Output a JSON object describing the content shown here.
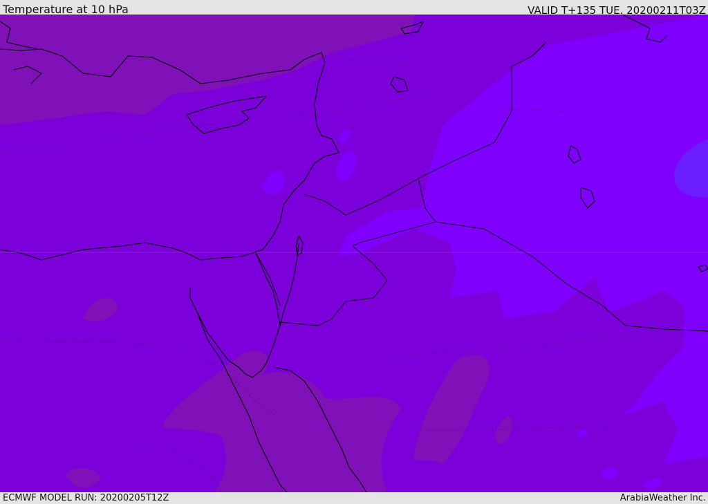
{
  "header": {
    "title": "Temperature at 10 hPa",
    "valid": "VALID T+135 TUE. 20200211T03Z"
  },
  "footer": {
    "model_run": "ECMWF MODEL RUN: 20200205T12Z",
    "credit": "ArabiaWeather Inc."
  },
  "map": {
    "colors": {
      "base": "#7c00d9",
      "warmer": "#8010b8",
      "cooler": "#7f00fd",
      "coldest": "#6a1eff",
      "coast": "#000000"
    },
    "icons": [
      "coastline-icon",
      "border-icon",
      "contour-icon"
    ]
  }
}
